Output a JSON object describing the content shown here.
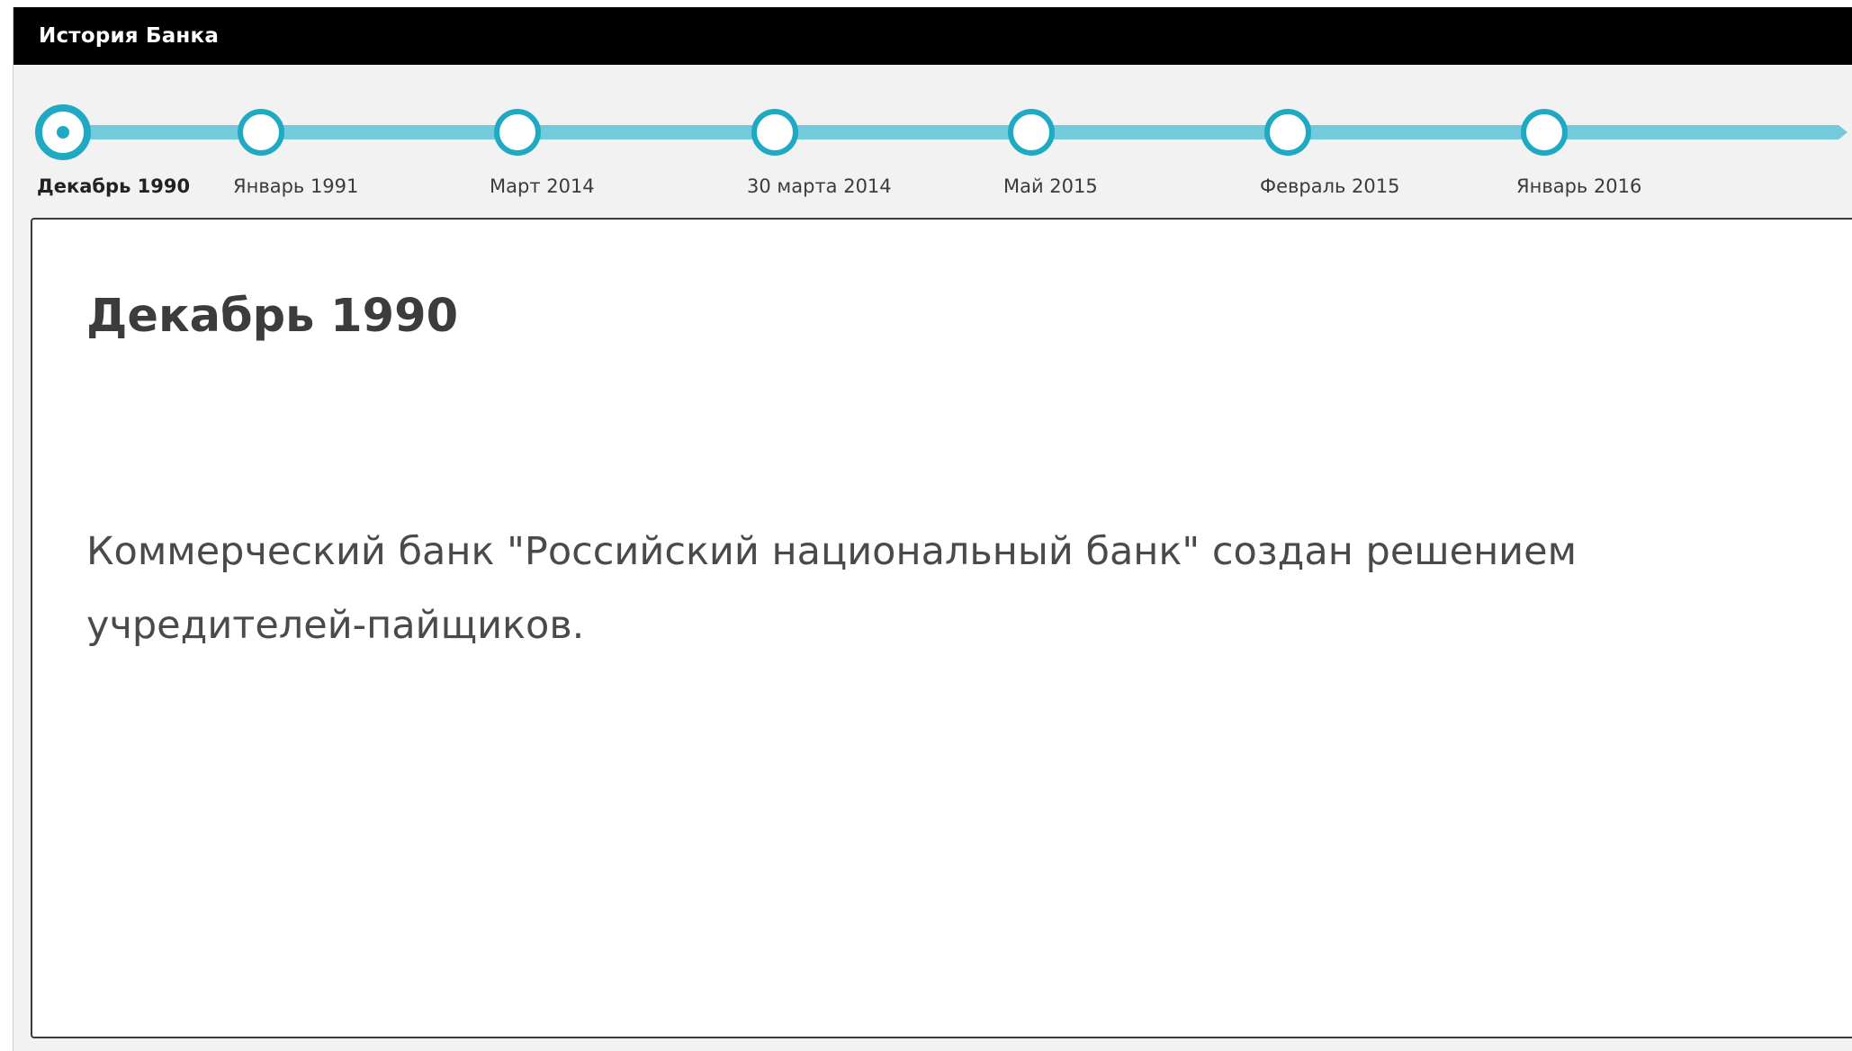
{
  "window": {
    "title": "История Банка"
  },
  "timeline": {
    "items": [
      {
        "label": "Декабрь 1990",
        "active": true
      },
      {
        "label": "Январь 1991",
        "active": false
      },
      {
        "label": "Март 2014",
        "active": false
      },
      {
        "label": "30 марта 2014",
        "active": false
      },
      {
        "label": "Май 2015",
        "active": false
      },
      {
        "label": "Февраль 2015",
        "active": false
      },
      {
        "label": "Январь 2016",
        "active": false
      }
    ]
  },
  "content": {
    "title": "Декабрь 1990",
    "text": "Коммерческий банк \"Российский национальный банк\" создан решением учредителей-пайщиков."
  },
  "colors": {
    "titlebar": "#000000",
    "accent": "#1fa9c3",
    "track": "#73cadb"
  }
}
